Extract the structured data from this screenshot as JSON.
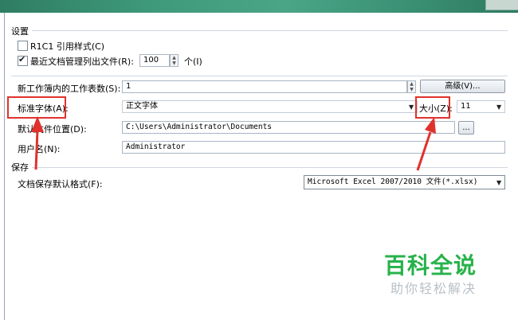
{
  "settings": {
    "section_title": "设置",
    "r1c1_label": "R1C1 引用样式(C)",
    "r1c1_checked": false,
    "recent_files_label": "最近文档管理列出文件(R):",
    "recent_files_checked": true,
    "recent_files_value": "100",
    "recent_files_unit": "个(I)",
    "sheets_label": "新工作簿内的工作表数(S):",
    "sheets_value": "1",
    "advanced_button": "高级(V)...",
    "font_label": "标准字体(A):",
    "font_value": "正文字体",
    "size_label": "大小(Z):",
    "size_value": "11",
    "location_label": "默认文件位置(D):",
    "location_value": "C:\\Users\\Administrator\\Documents",
    "browse_button": "...",
    "username_label": "用户名(N):",
    "username_value": "Administrator"
  },
  "save": {
    "section_title": "保存",
    "format_label": "文档保存默认格式(F):",
    "format_value": "Microsoft Excel 2007/2010 文件(*.xlsx)"
  },
  "watermark": {
    "brand": "百科全说",
    "slogan": "助你轻松解决"
  },
  "colors": {
    "highlight": "#e0322c",
    "watermark_green": "#27b24a"
  }
}
